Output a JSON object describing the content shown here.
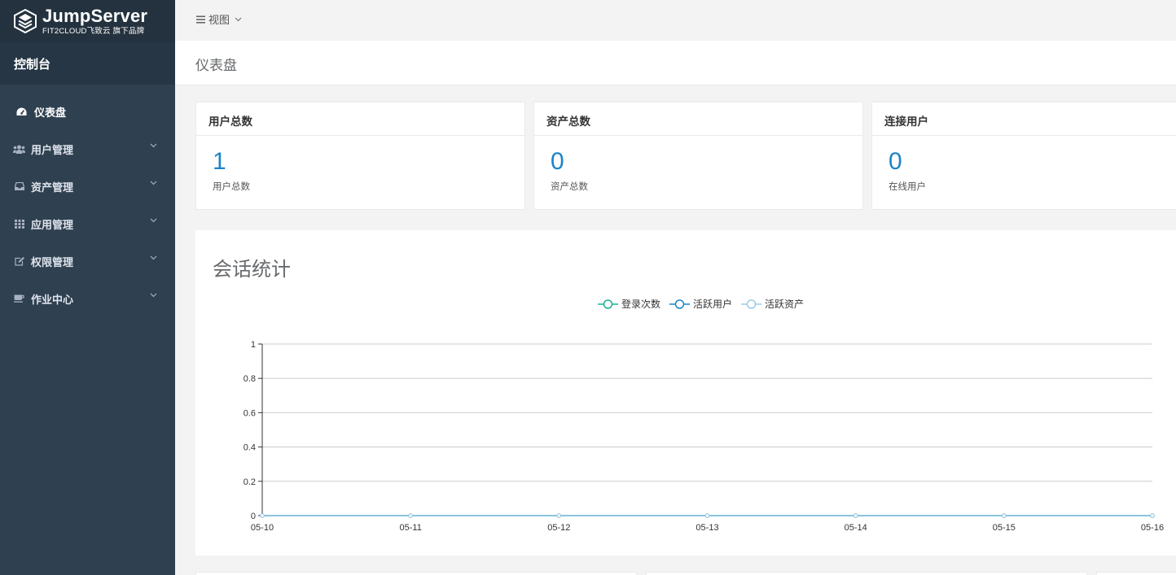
{
  "brand": {
    "name": "JumpServer",
    "sub": "FIT2CLOUD飞致云 旗下品牌"
  },
  "sidebar": {
    "console": "控制台",
    "items": [
      {
        "label": "仪表盘",
        "icon": "dashboard-icon",
        "active": true
      },
      {
        "label": "用户管理",
        "icon": "users-icon",
        "expandable": true
      },
      {
        "label": "资产管理",
        "icon": "inbox-icon",
        "expandable": true
      },
      {
        "label": "应用管理",
        "icon": "grid-icon",
        "expandable": true
      },
      {
        "label": "权限管理",
        "icon": "edit-icon",
        "expandable": true
      },
      {
        "label": "作业中心",
        "icon": "coffee-icon",
        "expandable": true
      }
    ]
  },
  "topbar": {
    "view_label": "视图"
  },
  "page": {
    "title": "仪表盘"
  },
  "cards": [
    {
      "title": "用户总数",
      "value": "1",
      "subtitle": "用户总数"
    },
    {
      "title": "资产总数",
      "value": "0",
      "subtitle": "资产总数"
    },
    {
      "title": "连接用户",
      "value": "0",
      "subtitle": "在线用户"
    }
  ],
  "session_stats": {
    "title": "会话统计"
  },
  "colors": {
    "sidebar": "#2f4050",
    "accent": "#1c84c6",
    "series_login": "#1ab394",
    "series_active_users": "#1c84c6",
    "series_active_assets": "#9ecbe6"
  },
  "chart_data": {
    "type": "line",
    "title": "会话统计",
    "x": [
      "05-10",
      "05-11",
      "05-12",
      "05-13",
      "05-14",
      "05-15",
      "05-16"
    ],
    "series": [
      {
        "name": "登录次数",
        "values": [
          0,
          0,
          0,
          0,
          0,
          0,
          0
        ]
      },
      {
        "name": "活跃用户",
        "values": [
          0,
          0,
          0,
          0,
          0,
          0,
          0
        ]
      },
      {
        "name": "活跃资产",
        "values": [
          0,
          0,
          0,
          0,
          0,
          0,
          0
        ]
      }
    ],
    "ylim": [
      0,
      1
    ],
    "yticks": [
      "0",
      "0.2",
      "0.4",
      "0.6",
      "0.8",
      "1"
    ],
    "grid": true,
    "legend": "top-center"
  }
}
